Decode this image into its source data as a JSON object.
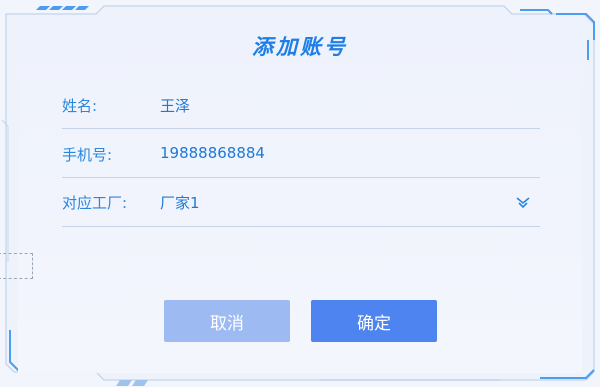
{
  "dialog": {
    "title": "添加账号",
    "fields": [
      {
        "label": "姓名:",
        "value": "王泽"
      },
      {
        "label": "手机号:",
        "value": "19888868884"
      },
      {
        "label": "对应工厂:",
        "value": "厂家1",
        "icon": "chevron-down-icon"
      }
    ],
    "cancel_label": "取消",
    "confirm_label": "确定"
  },
  "colors": {
    "accent": "#1f7fe6",
    "confirm_button": "#4d84f0",
    "cancel_button": "#9dbaf2",
    "frame": "#4c9cf0"
  }
}
